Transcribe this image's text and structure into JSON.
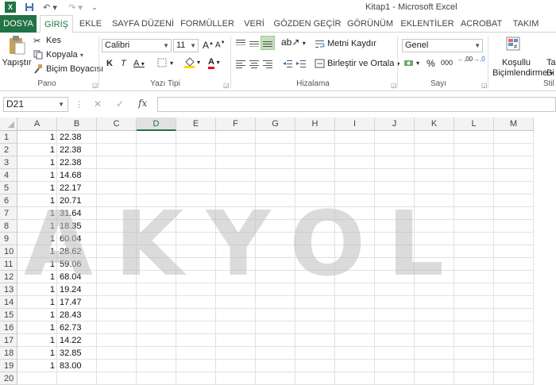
{
  "window": {
    "title": "Kitap1 - Microsoft Excel"
  },
  "quick_access": {
    "icons": [
      "excel-logo-icon",
      "save-icon",
      "undo-icon",
      "redo-icon",
      "customize-icon"
    ]
  },
  "tabs": [
    {
      "label": "DOSYA"
    },
    {
      "label": "GİRİŞ"
    },
    {
      "label": "EKLE"
    },
    {
      "label": "SAYFA DÜZENİ"
    },
    {
      "label": "FORMÜLLER"
    },
    {
      "label": "VERİ"
    },
    {
      "label": "GÖZDEN GEÇİR"
    },
    {
      "label": "GÖRÜNÜM"
    },
    {
      "label": "EKLENTİLER"
    },
    {
      "label": "ACROBAT"
    },
    {
      "label": "TAKIM"
    }
  ],
  "ribbon": {
    "clipboard": {
      "paste": "Yapıştır",
      "cut": "Kes",
      "copy": "Kopyala",
      "format_painter": "Biçim Boyacısı",
      "group": "Pano"
    },
    "font": {
      "name": "Calibri",
      "size": "11",
      "bold": "K",
      "italic": "T",
      "underline": "A",
      "grow": "A",
      "shrink": "A",
      "font_color": "A",
      "group": "Yazı Tipi"
    },
    "alignment": {
      "wrap": "Metni Kaydır",
      "merge": "Birleştir ve Ortala",
      "group": "Hizalama"
    },
    "number": {
      "format": "Genel",
      "percent": "%",
      "comma": "000",
      "inc_decimal": ",00",
      "group": "Sayı"
    },
    "styles": {
      "conditional_1": "Koşullu",
      "conditional_2": "Biçimlendirme",
      "table_1": "Ta",
      "table_2": "Bi",
      "group": "Stil"
    }
  },
  "formula_bar": {
    "name_box": "D21",
    "fx": "fx",
    "cancel": "✕",
    "enter": "✓",
    "content": ""
  },
  "sheet": {
    "columns": [
      "A",
      "B",
      "C",
      "D",
      "E",
      "F",
      "G",
      "H",
      "I",
      "J",
      "K",
      "L",
      "M"
    ],
    "selected_column": "D",
    "rows": [
      {
        "n": "1",
        "a": "1",
        "b": "22.38"
      },
      {
        "n": "2",
        "a": "1",
        "b": "22.38"
      },
      {
        "n": "3",
        "a": "1",
        "b": "22.38"
      },
      {
        "n": "4",
        "a": "1",
        "b": "14.68"
      },
      {
        "n": "5",
        "a": "1",
        "b": "22.17"
      },
      {
        "n": "6",
        "a": "1",
        "b": "20.71"
      },
      {
        "n": "7",
        "a": "1",
        "b": "31.64"
      },
      {
        "n": "8",
        "a": "1",
        "b": "18.35"
      },
      {
        "n": "9",
        "a": "1",
        "b": "60.04"
      },
      {
        "n": "10",
        "a": "1",
        "b": "28.62"
      },
      {
        "n": "11",
        "a": "1",
        "b": "59.06"
      },
      {
        "n": "12",
        "a": "1",
        "b": "68.04"
      },
      {
        "n": "13",
        "a": "1",
        "b": "19.24"
      },
      {
        "n": "14",
        "a": "1",
        "b": "17.47"
      },
      {
        "n": "15",
        "a": "1",
        "b": "28.43"
      },
      {
        "n": "16",
        "a": "1",
        "b": "62.73"
      },
      {
        "n": "17",
        "a": "1",
        "b": "14.22"
      },
      {
        "n": "18",
        "a": "1",
        "b": "32.85"
      },
      {
        "n": "19",
        "a": "1",
        "b": "83.00"
      },
      {
        "n": "20",
        "a": "",
        "b": ""
      }
    ]
  },
  "watermark": "AKYOL",
  "colors": {
    "accent": "#217346",
    "header_bg": "#f3f3f3",
    "grid_line": "#e1e1e1"
  }
}
